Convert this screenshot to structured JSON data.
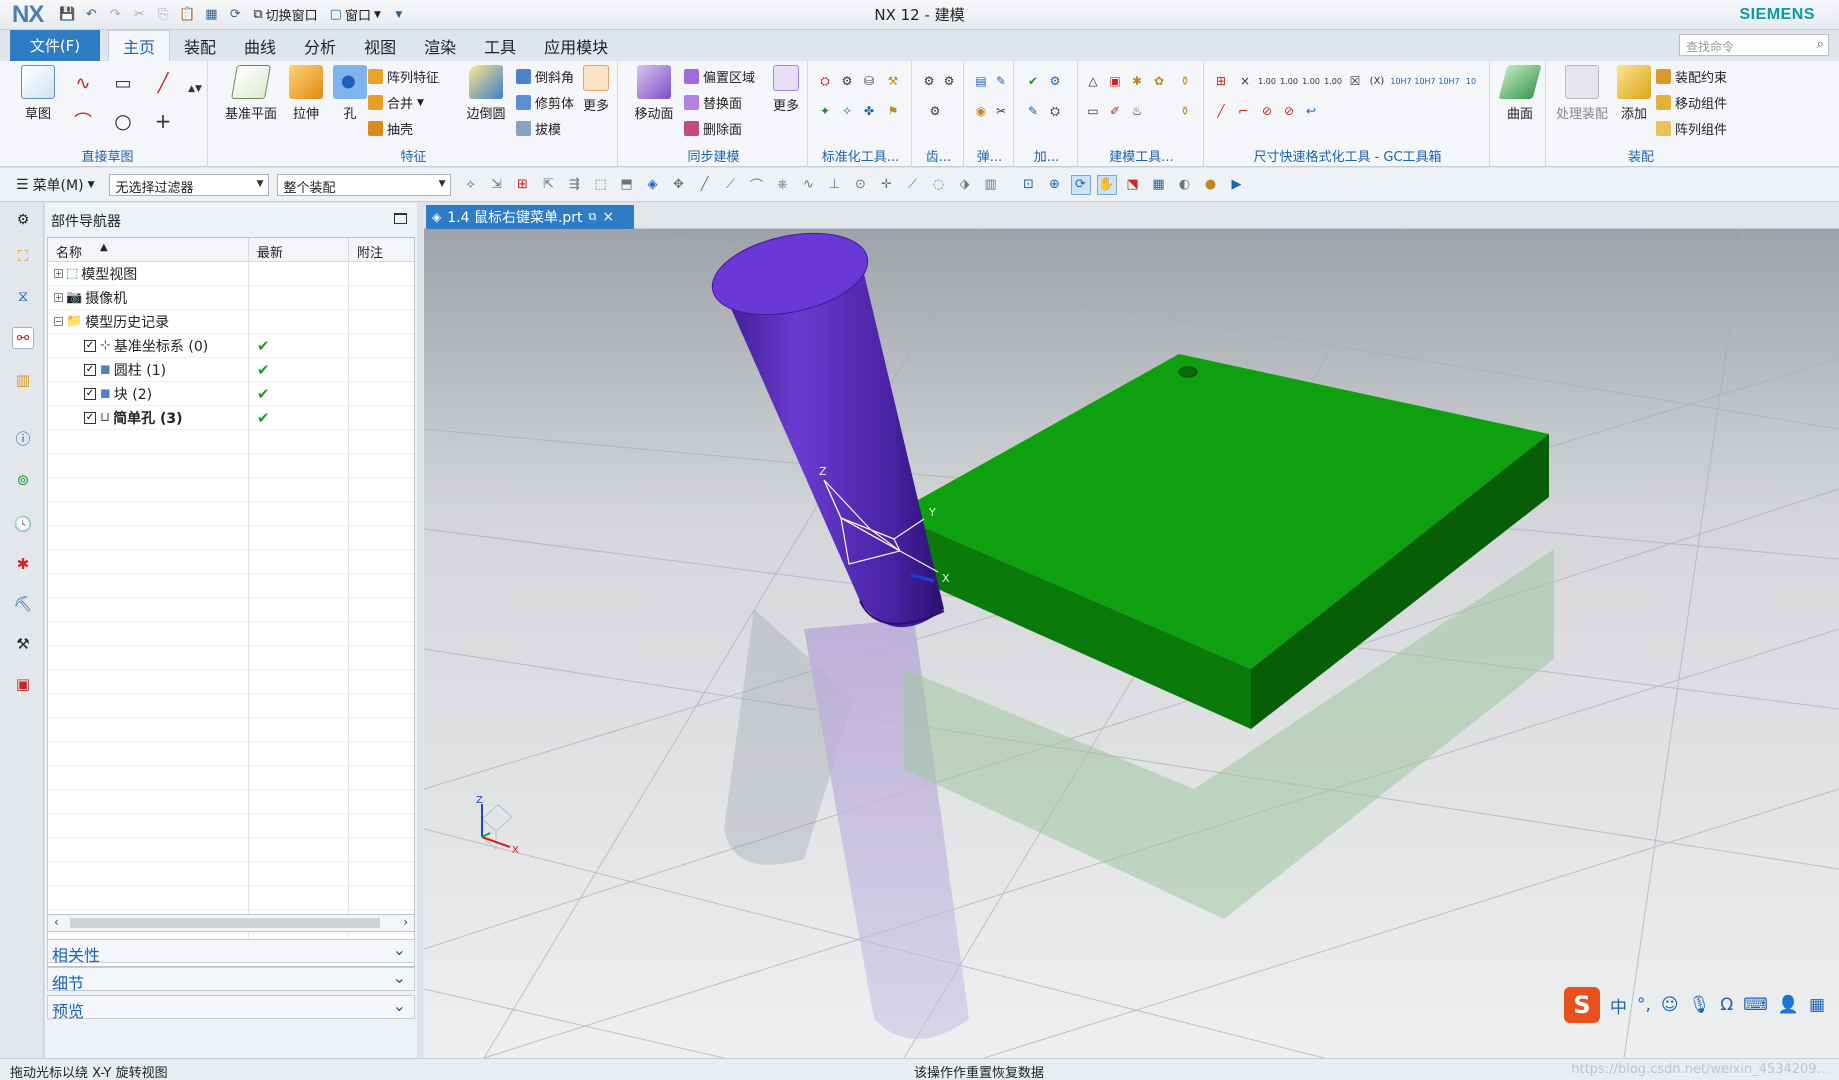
{
  "titlebar": {
    "logo": "NX",
    "title": "NX 12 - 建模",
    "brand": "SIEMENS",
    "switch_window": "切换窗口",
    "window": "窗口"
  },
  "menu": {
    "file": "文件(F)",
    "tabs": [
      "主页",
      "装配",
      "曲线",
      "分析",
      "视图",
      "渲染",
      "工具",
      "应用模块"
    ],
    "active_tab": "主页",
    "search_placeholder": "查找命令"
  },
  "ribbon": {
    "groups": {
      "sketch": {
        "label": "直接草图",
        "btn": "草图"
      },
      "feature": {
        "label": "特征",
        "datum_plane": "基准平面",
        "extrude": "拉伸",
        "hole": "孔",
        "pattern": "阵列特征",
        "unite": "合并",
        "shell": "抽壳",
        "edge_blend": "边倒圆",
        "chamfer": "倒斜角",
        "trim_body": "修剪体",
        "draft": "拔模",
        "more": "更多"
      },
      "sync": {
        "label": "同步建模",
        "move_face": "移动面",
        "offset_region": "偏置区域",
        "replace_face": "替换面",
        "delete_face": "删除面",
        "more": "更多"
      },
      "standard": {
        "label": "标准化工具..."
      },
      "gear": {
        "label": "齿..."
      },
      "spring": {
        "label": "弹..."
      },
      "add": {
        "label": "加..."
      },
      "modeling_tools": {
        "label": "建模工具..."
      },
      "dim": {
        "label": "尺寸快速格式化工具 - GC工具箱"
      },
      "surface": {
        "btn": "曲面"
      },
      "assembly": {
        "label": "装配",
        "process": "处理装配",
        "add": "添加",
        "constraint": "装配约束",
        "move_component": "移动组件",
        "pattern_component": "阵列组件"
      }
    }
  },
  "toolbar2": {
    "menu": "菜单(M)",
    "filter": "无选择过滤器",
    "scope": "整个装配"
  },
  "navigator": {
    "title": "部件导航器",
    "columns": [
      "名称",
      "最新",
      "附注"
    ],
    "rows": [
      {
        "name": "模型视图",
        "level": 0,
        "expander": "+",
        "check": false,
        "latest": ""
      },
      {
        "name": "摄像机",
        "level": 0,
        "expander": "+",
        "check": false,
        "latest": ""
      },
      {
        "name": "模型历史记录",
        "level": 0,
        "expander": "−",
        "check": false,
        "latest": ""
      },
      {
        "name": "基准坐标系 (0)",
        "level": 1,
        "expander": "",
        "check": true,
        "latest": "✔"
      },
      {
        "name": "圆柱 (1)",
        "level": 1,
        "expander": "",
        "check": true,
        "latest": "✔"
      },
      {
        "name": "块 (2)",
        "level": 1,
        "expander": "",
        "check": true,
        "latest": "✔"
      },
      {
        "name": "简单孔 (3)",
        "level": 1,
        "expander": "",
        "check": true,
        "latest": "✔",
        "bold": true
      }
    ],
    "panels": [
      "相关性",
      "细节",
      "预览"
    ]
  },
  "document": {
    "tab": "1.4 鼠标右键菜单.prt"
  },
  "csys": {
    "z": "Z",
    "y": "Y",
    "x": "X"
  },
  "ime": {
    "logo": "S",
    "lang": "中"
  },
  "status": {
    "left": "拖动光标以绕 X-Y 旋转视图",
    "middle": "该操作作重置恢复数据",
    "watermark": "https://blog.csdn.net/weixin_4534209..."
  },
  "colors": {
    "accent": "#2f7cc4",
    "cylinder": "#5a2bb5",
    "block": "#0fa00f",
    "brand": "#0a9ca3"
  }
}
